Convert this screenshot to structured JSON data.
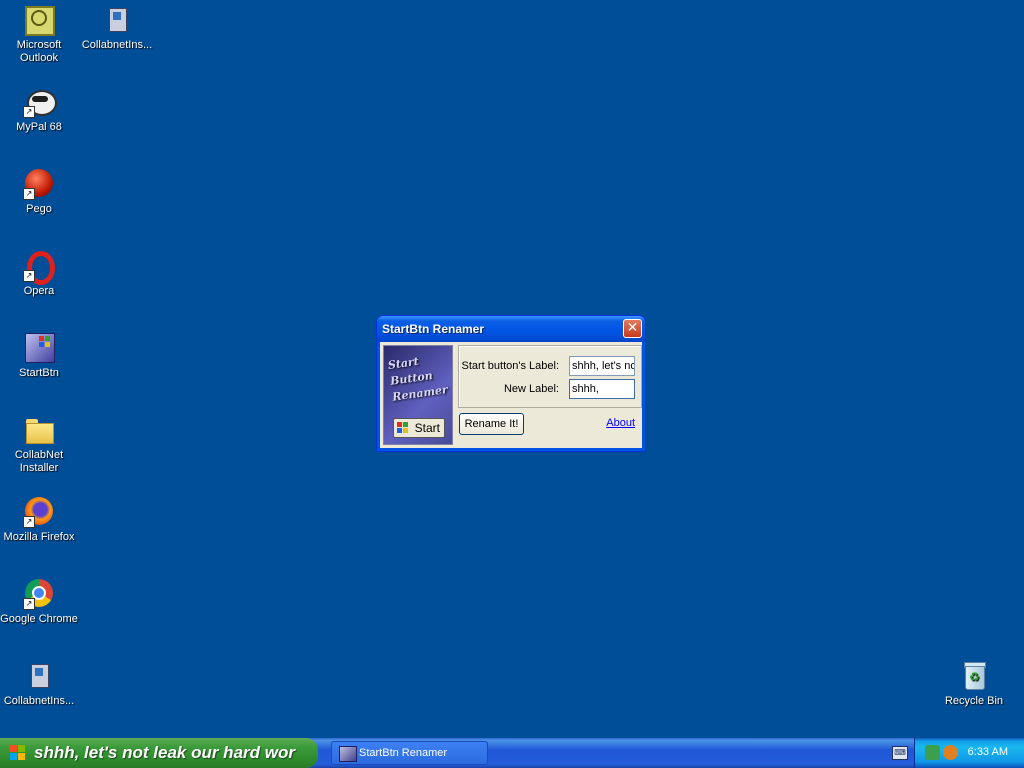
{
  "desktop": {
    "icons": [
      {
        "label_line1": "Microsoft",
        "label_line2": "Outlook"
      },
      {
        "label_line1": "CollabnetIns...",
        "label_line2": ""
      },
      {
        "label_line1": "MyPal 68",
        "label_line2": ""
      },
      {
        "label_line1": "Pego",
        "label_line2": ""
      },
      {
        "label_line1": "Opera",
        "label_line2": ""
      },
      {
        "label_line1": "StartBtn",
        "label_line2": ""
      },
      {
        "label_line1": "CollabNet",
        "label_line2": "Installer"
      },
      {
        "label_line1": "Mozilla Firefox",
        "label_line2": ""
      },
      {
        "label_line1": "Google Chrome",
        "label_line2": ""
      },
      {
        "label_line1": "CollabnetIns...",
        "label_line2": ""
      },
      {
        "label_line1": "Recycle Bin",
        "label_line2": ""
      }
    ]
  },
  "dialog": {
    "title": "StartBtn Renamer",
    "close_glyph": "✕",
    "logo_line1": "Start",
    "logo_line2": "Button",
    "logo_line3": "Renamer",
    "logo_start_label": "Start",
    "current_label_caption": "Start button's Label:",
    "current_label_value": "shhh, let's not leak our hard wor",
    "new_label_caption": "New Label:",
    "new_label_value": "shhh,",
    "rename_button": "Rename It!",
    "about_link": "About"
  },
  "taskbar": {
    "start_label": "shhh, let's not leak our hard wor",
    "task_items": [
      {
        "label": "StartBtn Renamer"
      }
    ],
    "clock": "6:33 AM"
  },
  "icons": {
    "outlook": "outlook-icon",
    "collabnet": "installer-icon",
    "mypal": "mypal-icon",
    "pego": "pego-icon",
    "opera": "opera-icon",
    "startbtn": "startbtn-icon",
    "folder": "folder-icon",
    "firefox": "firefox-icon",
    "chrome": "chrome-icon",
    "recycle": "recycle-bin-icon"
  },
  "colors": {
    "desktop_bg": "#004e98",
    "start_green": "#3c9b3a",
    "taskbar_blue": "#245edb",
    "tray_blue": "#1096e6",
    "title_blue": "#0054e3"
  }
}
